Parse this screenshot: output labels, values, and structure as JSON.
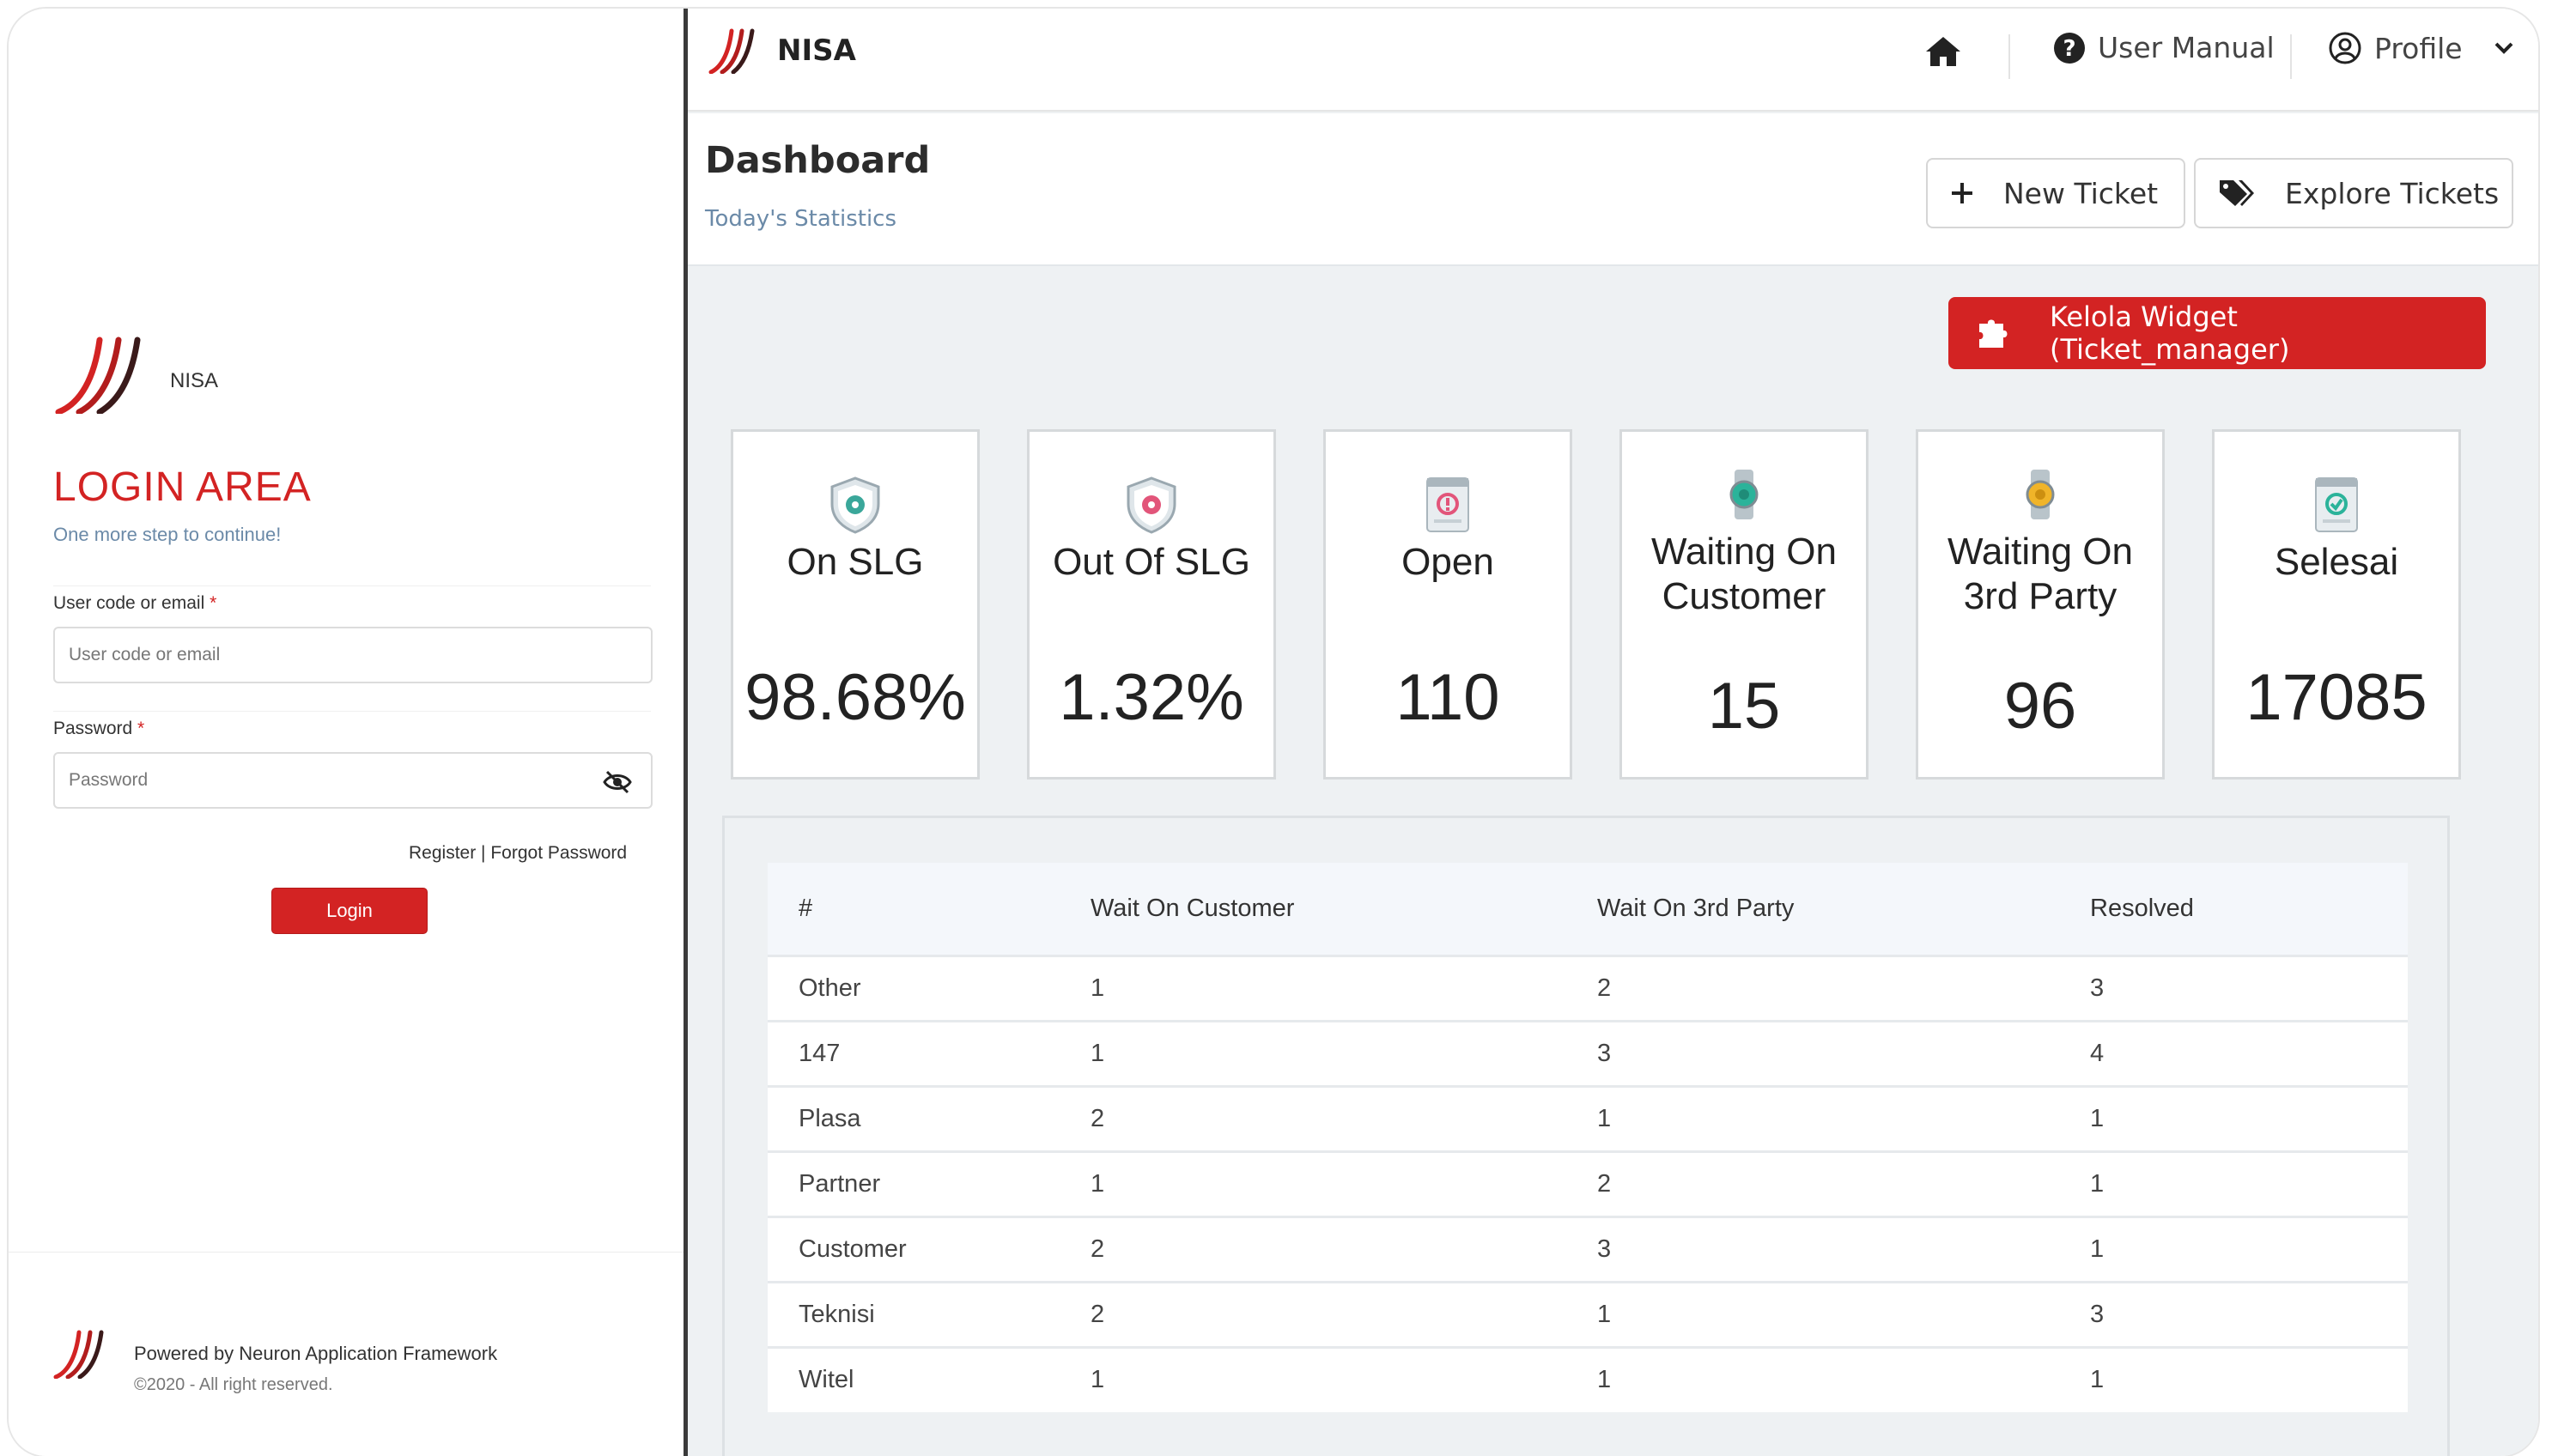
{
  "brand": {
    "name": "NISA"
  },
  "login": {
    "title": "LOGIN AREA",
    "subtitle": "One more step to continue!",
    "user_label": "User code or email",
    "user_placeholder": "User code or email",
    "password_label": "Password",
    "password_placeholder": "Password",
    "required_mark": "*",
    "register": "Register",
    "separator": "|",
    "forgot": "Forgot Password",
    "login_button": "Login",
    "footer_line1": "Powered by Neuron Application Framework",
    "footer_line2": "©2020 - All right reserved."
  },
  "topbar": {
    "brand": "NISA",
    "user_manual": "User Manual",
    "profile": "Profile"
  },
  "header": {
    "title": "Dashboard",
    "subtitle": "Today's Statistics",
    "new_ticket": "New Ticket",
    "explore_tickets": "Explore Tickets"
  },
  "widget_button": "Kelola Widget (Ticket_manager)",
  "cards": [
    {
      "label": "On SLG",
      "value": "98.68%",
      "icon": "shield-gear-icon"
    },
    {
      "label": "Out Of SLG",
      "value": "1.32%",
      "icon": "shield-gear-icon"
    },
    {
      "label": "Open",
      "value": "110",
      "icon": "ticket-alert-icon"
    },
    {
      "label": "Waiting On Customer",
      "value": "15",
      "icon": "watch-icon"
    },
    {
      "label": "Waiting On 3rd Party",
      "value": "96",
      "icon": "watch-icon"
    },
    {
      "label": "Selesai",
      "value": "17085",
      "icon": "ticket-check-icon"
    }
  ],
  "table": {
    "headers": [
      "#",
      "Wait On Customer",
      "Wait On 3rd Party",
      "Resolved"
    ],
    "rows": [
      [
        "Other",
        "1",
        "2",
        "3"
      ],
      [
        "147",
        "1",
        "3",
        "4"
      ],
      [
        "Plasa",
        "2",
        "1",
        "1"
      ],
      [
        "Partner",
        "1",
        "2",
        "1"
      ],
      [
        "Customer",
        "2",
        "3",
        "1"
      ],
      [
        "Teknisi",
        "2",
        "1",
        "3"
      ],
      [
        "Witel",
        "1",
        "1",
        "1"
      ]
    ]
  },
  "colors": {
    "accent_red": "#d32323",
    "link_blue": "#6b8aa8",
    "shield_teal": "#3aa79a",
    "shield_pink": "#e2557a",
    "watch_teal": "#2bb39a",
    "watch_amber": "#f0b429"
  }
}
